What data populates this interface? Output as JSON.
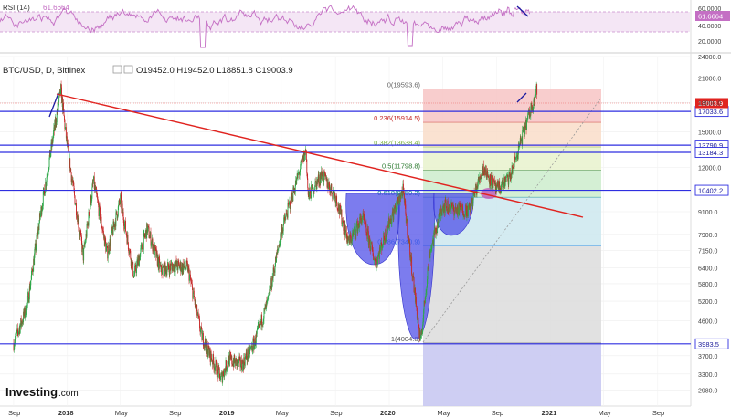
{
  "rsi_panel": {
    "label": "RSI (14)",
    "value": "61.6664",
    "badge": "61.6664",
    "levels": [
      "60.0000",
      "40.0000",
      "20.0000"
    ]
  },
  "header": {
    "symbol": "BTC/USD, D, Bitfinex",
    "ohlc": "O19452.0 H19452.0 L18851.8 C19003.9"
  },
  "brand": {
    "name": "Investing",
    "suffix": ".com"
  },
  "colors": {
    "up": "#2ea84a",
    "down": "#c62828",
    "rsi": "#c46fc4",
    "hline": "#2f2fe0",
    "trendline": "#e0231f",
    "pattern": "#4a4ae8"
  },
  "chart_data": {
    "type": "candlestick",
    "title": "",
    "xlabel": "",
    "ylabel": "",
    "y_scale": "log",
    "ylim": [
      2700,
      24000
    ],
    "y_ticks": [
      "24000.0",
      "21000.0",
      "18000.0",
      "15000.0",
      "12000.0",
      "9100.0",
      "7900.0",
      "7150.0",
      "6400.0",
      "5800.0",
      "5200.0",
      "4600.0",
      "3700.0",
      "3300.0",
      "2980.0"
    ],
    "x_ticks": [
      "Sep",
      "2018",
      "May",
      "Sep",
      "2019",
      "May",
      "Sep",
      "2020",
      "May",
      "Sep",
      "2021",
      "May",
      "Sep"
    ],
    "price_path": [
      [
        "2017-09",
        4000
      ],
      [
        "2017-10",
        5000
      ],
      [
        "2017-11",
        9000
      ],
      [
        "2017-12-17",
        19500
      ],
      [
        "2018-01",
        13500
      ],
      [
        "2018-02-06",
        6900
      ],
      [
        "2018-03",
        11000
      ],
      [
        "2018-04",
        7000
      ],
      [
        "2018-05",
        9800
      ],
      [
        "2018-06",
        6100
      ],
      [
        "2018-07",
        8200
      ],
      [
        "2018-08",
        6300
      ],
      [
        "2018-09",
        6500
      ],
      [
        "2018-10",
        6400
      ],
      [
        "2018-11",
        4200
      ],
      [
        "2018-12-15",
        3200
      ],
      [
        "2019-01",
        3600
      ],
      [
        "2019-02",
        3500
      ],
      [
        "2019-03",
        4000
      ],
      [
        "2019-04",
        5200
      ],
      [
        "2019-05",
        8000
      ],
      [
        "2019-06-26",
        13400
      ],
      [
        "2019-07",
        10000
      ],
      [
        "2019-08",
        11500
      ],
      [
        "2019-09",
        10000
      ],
      [
        "2019-10",
        7500
      ],
      [
        "2019-11",
        8800
      ],
      [
        "2019-12",
        6600
      ],
      [
        "2020-01",
        8500
      ],
      [
        "2020-02",
        10400
      ],
      [
        "2020-03-12",
        3984
      ],
      [
        "2020-04",
        7000
      ],
      [
        "2020-05",
        9500
      ],
      [
        "2020-06",
        9200
      ],
      [
        "2020-07",
        9200
      ],
      [
        "2020-08",
        12000
      ],
      [
        "2020-09",
        10400
      ],
      [
        "2020-10",
        11300
      ],
      [
        "2020-11",
        15000
      ],
      [
        "2020-12-01",
        19593
      ]
    ],
    "fibonacci": [
      {
        "label": "0(19593.6)",
        "value": 19593.6
      },
      {
        "label": "0.236(15914.5)",
        "value": 15914.5
      },
      {
        "label": "0.382(13638.4)",
        "value": 13638.4
      },
      {
        "label": "0.5(11798.8)",
        "value": 11798.8
      },
      {
        "label": "0.618(9959.2)",
        "value": 9959.2
      },
      {
        "label": "0.786(7340.9)",
        "value": 7340.9
      },
      {
        "label": "1(4004.8)",
        "value": 4004.8
      }
    ],
    "horizontal_levels": [
      {
        "label": "17033.6",
        "value": 17033.6
      },
      {
        "label": "13790.9",
        "value": 13790.9
      },
      {
        "label": "13184.3",
        "value": 13184.3
      },
      {
        "label": "10402.2",
        "value": 10402.2
      },
      {
        "label": "3983.5",
        "value": 3983.5
      }
    ],
    "last_price": {
      "label": "19003.9",
      "value": 19003.9
    },
    "trendline": {
      "from": [
        "2017-12-17",
        19500
      ],
      "to": [
        "2021-04",
        9000
      ]
    },
    "pattern": "inverse head and shoulders with neckline at 10402.2"
  }
}
